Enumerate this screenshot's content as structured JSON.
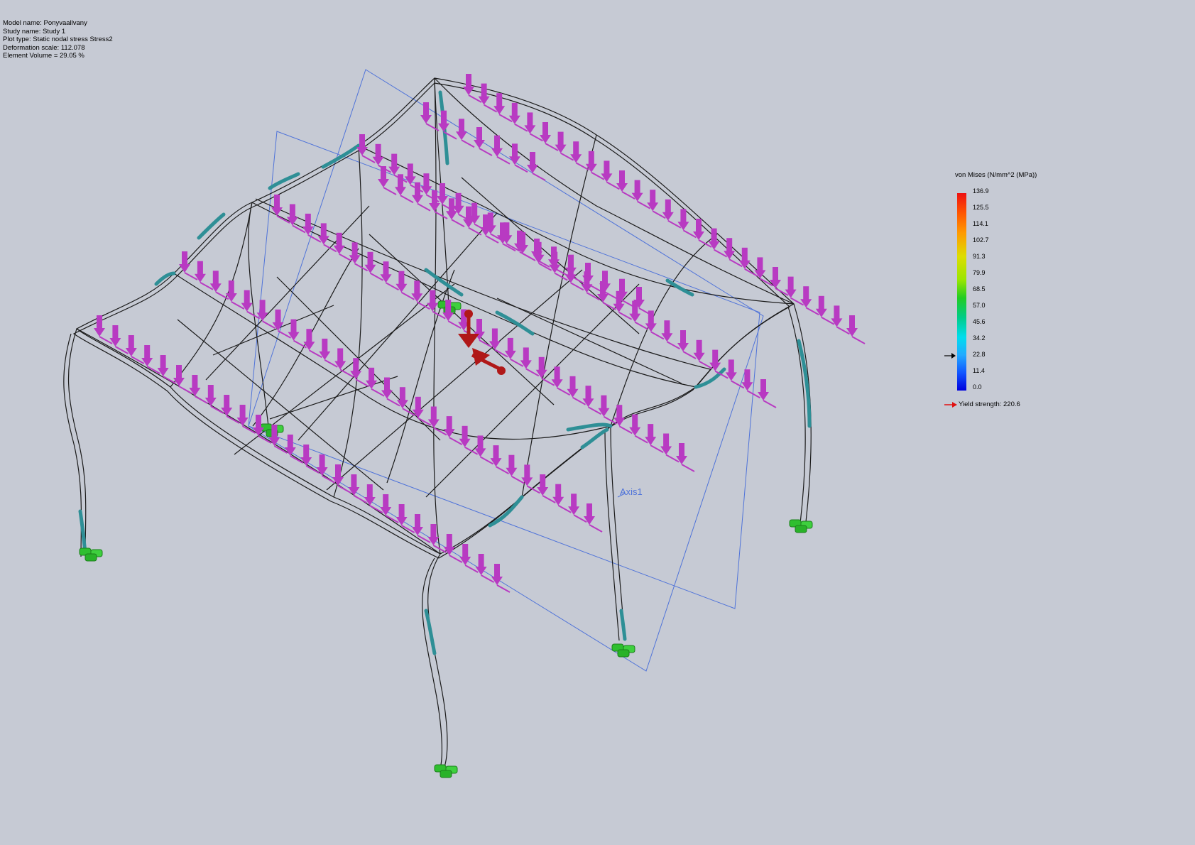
{
  "info": {
    "model_name": "Model name: Ponyvaallvany",
    "study_name": "Study name: Study 1",
    "plot_type": "Plot type: Static nodal stress Stress2",
    "deformation_scale": "Deformation scale: 112.078",
    "element_volume": "Element Volume = 29.05 %"
  },
  "legend": {
    "title": "von Mises (N/mm^2 (MPa))",
    "ticks": [
      "136.9",
      "125.5",
      "114.1",
      "102.7",
      "91.3",
      "79.9",
      "68.5",
      "57.0",
      "45.6",
      "34.2",
      "22.8",
      "11.4",
      "0.0"
    ],
    "yield_strength": "Yield strength: 220.6"
  },
  "axis_label": "Axis1",
  "colors": {
    "background": "#c6cad4",
    "load_arrow": "#b83ac2",
    "fixture": "#2fbf2f",
    "frame": "#1a1a1a",
    "stress_teal": "#2e8f96",
    "plane": "#4f73d9",
    "triad": "#b01818"
  }
}
